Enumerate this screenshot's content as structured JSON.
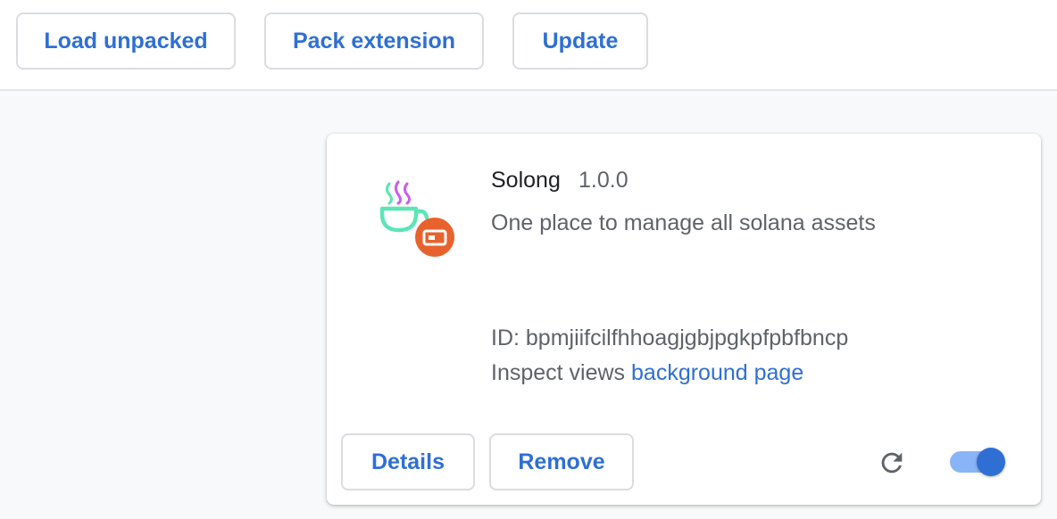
{
  "toolbar": {
    "load_unpacked": "Load unpacked",
    "pack_extension": "Pack extension",
    "update": "Update"
  },
  "extension": {
    "name": "Solong",
    "version": "1.0.0",
    "description": "One place to manage all solana assets",
    "id_text": "ID: bpmjiifcilfhhoagjgbjpgkpfpbfbncp",
    "inspect_label": "Inspect views",
    "inspect_link": "background page",
    "details_label": "Details",
    "remove_label": "Remove",
    "enabled": true,
    "icon": "teacup-steam-icon",
    "badge_icon": "unpacked-extension-badge-icon",
    "reload_icon": "reload-icon"
  },
  "colors": {
    "accent": "#2f6fd3",
    "toggle_track": "#8ab4f8",
    "badge": "#e8622e",
    "cup": "#5ce5b5",
    "steam": "#c85cf0"
  }
}
